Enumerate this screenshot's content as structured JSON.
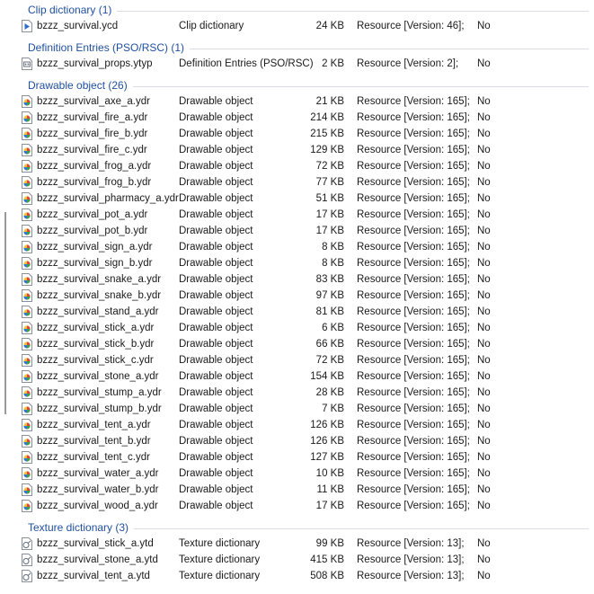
{
  "groups": [
    {
      "name": "Clip dictionary (1)",
      "icon": "clip-file-icon",
      "items": [
        {
          "name": "bzzz_survival.ycd",
          "type": "Clip dictionary",
          "size": "24 KB",
          "resource": "Resource [Version: 46];",
          "readonly": "No"
        }
      ]
    },
    {
      "name": "Definition Entries (PSO/RSC) (1)",
      "icon": "definition-file-icon",
      "items": [
        {
          "name": "bzzz_survival_props.ytyp",
          "type": "Definition Entries (PSO/RSC)",
          "size": "2 KB",
          "resource": "Resource [Version: 2];",
          "readonly": "No"
        }
      ]
    },
    {
      "name": "Drawable object (26)",
      "icon": "drawable-file-icon",
      "items": [
        {
          "name": "bzzz_survival_axe_a.ydr",
          "type": "Drawable object",
          "size": "21 KB",
          "resource": "Resource [Version: 165];",
          "readonly": "No"
        },
        {
          "name": "bzzz_survival_fire_a.ydr",
          "type": "Drawable object",
          "size": "214 KB",
          "resource": "Resource [Version: 165];",
          "readonly": "No"
        },
        {
          "name": "bzzz_survival_fire_b.ydr",
          "type": "Drawable object",
          "size": "215 KB",
          "resource": "Resource [Version: 165];",
          "readonly": "No"
        },
        {
          "name": "bzzz_survival_fire_c.ydr",
          "type": "Drawable object",
          "size": "129 KB",
          "resource": "Resource [Version: 165];",
          "readonly": "No"
        },
        {
          "name": "bzzz_survival_frog_a.ydr",
          "type": "Drawable object",
          "size": "72 KB",
          "resource": "Resource [Version: 165];",
          "readonly": "No"
        },
        {
          "name": "bzzz_survival_frog_b.ydr",
          "type": "Drawable object",
          "size": "77 KB",
          "resource": "Resource [Version: 165];",
          "readonly": "No"
        },
        {
          "name": "bzzz_survival_pharmacy_a.ydr",
          "type": "Drawable object",
          "size": "51 KB",
          "resource": "Resource [Version: 165];",
          "readonly": "No"
        },
        {
          "name": "bzzz_survival_pot_a.ydr",
          "type": "Drawable object",
          "size": "17 KB",
          "resource": "Resource [Version: 165];",
          "readonly": "No"
        },
        {
          "name": "bzzz_survival_pot_b.ydr",
          "type": "Drawable object",
          "size": "17 KB",
          "resource": "Resource [Version: 165];",
          "readonly": "No"
        },
        {
          "name": "bzzz_survival_sign_a.ydr",
          "type": "Drawable object",
          "size": "8 KB",
          "resource": "Resource [Version: 165];",
          "readonly": "No"
        },
        {
          "name": "bzzz_survival_sign_b.ydr",
          "type": "Drawable object",
          "size": "8 KB",
          "resource": "Resource [Version: 165];",
          "readonly": "No"
        },
        {
          "name": "bzzz_survival_snake_a.ydr",
          "type": "Drawable object",
          "size": "83 KB",
          "resource": "Resource [Version: 165];",
          "readonly": "No"
        },
        {
          "name": "bzzz_survival_snake_b.ydr",
          "type": "Drawable object",
          "size": "97 KB",
          "resource": "Resource [Version: 165];",
          "readonly": "No"
        },
        {
          "name": "bzzz_survival_stand_a.ydr",
          "type": "Drawable object",
          "size": "81 KB",
          "resource": "Resource [Version: 165];",
          "readonly": "No"
        },
        {
          "name": "bzzz_survival_stick_a.ydr",
          "type": "Drawable object",
          "size": "6 KB",
          "resource": "Resource [Version: 165];",
          "readonly": "No"
        },
        {
          "name": "bzzz_survival_stick_b.ydr",
          "type": "Drawable object",
          "size": "66 KB",
          "resource": "Resource [Version: 165];",
          "readonly": "No"
        },
        {
          "name": "bzzz_survival_stick_c.ydr",
          "type": "Drawable object",
          "size": "72 KB",
          "resource": "Resource [Version: 165];",
          "readonly": "No"
        },
        {
          "name": "bzzz_survival_stone_a.ydr",
          "type": "Drawable object",
          "size": "154 KB",
          "resource": "Resource [Version: 165];",
          "readonly": "No"
        },
        {
          "name": "bzzz_survival_stump_a.ydr",
          "type": "Drawable object",
          "size": "28 KB",
          "resource": "Resource [Version: 165];",
          "readonly": "No"
        },
        {
          "name": "bzzz_survival_stump_b.ydr",
          "type": "Drawable object",
          "size": "7 KB",
          "resource": "Resource [Version: 165];",
          "readonly": "No"
        },
        {
          "name": "bzzz_survival_tent_a.ydr",
          "type": "Drawable object",
          "size": "126 KB",
          "resource": "Resource [Version: 165];",
          "readonly": "No"
        },
        {
          "name": "bzzz_survival_tent_b.ydr",
          "type": "Drawable object",
          "size": "126 KB",
          "resource": "Resource [Version: 165];",
          "readonly": "No"
        },
        {
          "name": "bzzz_survival_tent_c.ydr",
          "type": "Drawable object",
          "size": "127 KB",
          "resource": "Resource [Version: 165];",
          "readonly": "No"
        },
        {
          "name": "bzzz_survival_water_a.ydr",
          "type": "Drawable object",
          "size": "10 KB",
          "resource": "Resource [Version: 165];",
          "readonly": "No"
        },
        {
          "name": "bzzz_survival_water_b.ydr",
          "type": "Drawable object",
          "size": "11 KB",
          "resource": "Resource [Version: 165];",
          "readonly": "No"
        },
        {
          "name": "bzzz_survival_wood_a.ydr",
          "type": "Drawable object",
          "size": "17 KB",
          "resource": "Resource [Version: 165];",
          "readonly": "No"
        }
      ]
    },
    {
      "name": "Texture dictionary (3)",
      "icon": "texture-file-icon",
      "items": [
        {
          "name": "bzzz_survival_stick_a.ytd",
          "type": "Texture dictionary",
          "size": "99 KB",
          "resource": "Resource [Version: 13];",
          "readonly": "No"
        },
        {
          "name": "bzzz_survival_stone_a.ytd",
          "type": "Texture dictionary",
          "size": "415 KB",
          "resource": "Resource [Version: 13];",
          "readonly": "No"
        },
        {
          "name": "bzzz_survival_tent_a.ytd",
          "type": "Texture dictionary",
          "size": "508 KB",
          "resource": "Resource [Version: 13];",
          "readonly": "No"
        }
      ]
    }
  ],
  "colors": {
    "group_header": "#1f4f9f",
    "group_line": "#dadde3",
    "text": "#1a1a1a"
  }
}
